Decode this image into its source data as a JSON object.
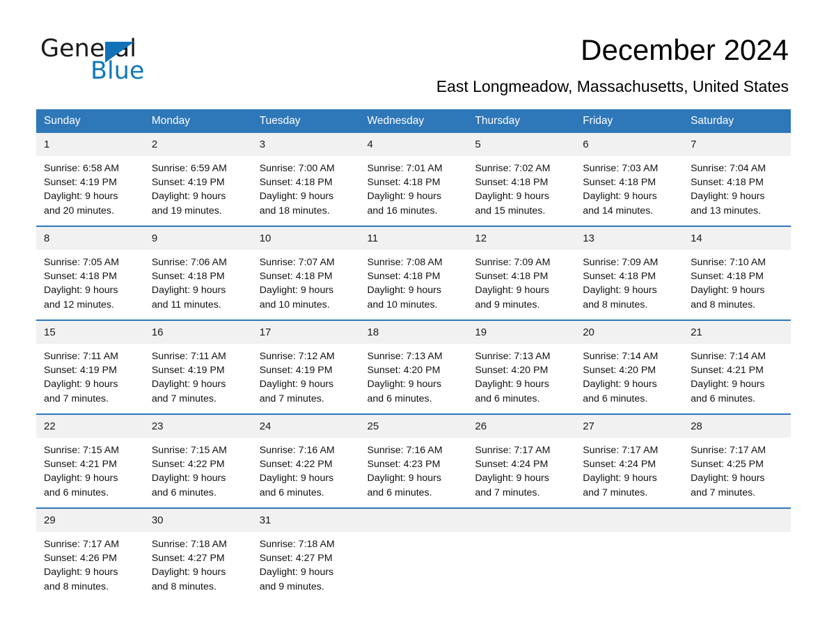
{
  "brand": {
    "name_part1": "General",
    "name_part2": "Blue",
    "triangle_color": "#1272b8",
    "blue_text_color": "#1278be"
  },
  "header": {
    "month_title": "December 2024",
    "location": "East Longmeadow, Massachusetts, United States"
  },
  "calendar": {
    "header_bg": "#2e77b8",
    "daynum_bg": "#f1f1f1",
    "weekday_headers": [
      "Sunday",
      "Monday",
      "Tuesday",
      "Wednesday",
      "Thursday",
      "Friday",
      "Saturday"
    ],
    "weeks": [
      [
        {
          "day": "1",
          "sunrise": "Sunrise: 6:58 AM",
          "sunset": "Sunset: 4:19 PM",
          "daylight_line1": "Daylight: 9 hours",
          "daylight_line2": "and 20 minutes."
        },
        {
          "day": "2",
          "sunrise": "Sunrise: 6:59 AM",
          "sunset": "Sunset: 4:19 PM",
          "daylight_line1": "Daylight: 9 hours",
          "daylight_line2": "and 19 minutes."
        },
        {
          "day": "3",
          "sunrise": "Sunrise: 7:00 AM",
          "sunset": "Sunset: 4:18 PM",
          "daylight_line1": "Daylight: 9 hours",
          "daylight_line2": "and 18 minutes."
        },
        {
          "day": "4",
          "sunrise": "Sunrise: 7:01 AM",
          "sunset": "Sunset: 4:18 PM",
          "daylight_line1": "Daylight: 9 hours",
          "daylight_line2": "and 16 minutes."
        },
        {
          "day": "5",
          "sunrise": "Sunrise: 7:02 AM",
          "sunset": "Sunset: 4:18 PM",
          "daylight_line1": "Daylight: 9 hours",
          "daylight_line2": "and 15 minutes."
        },
        {
          "day": "6",
          "sunrise": "Sunrise: 7:03 AM",
          "sunset": "Sunset: 4:18 PM",
          "daylight_line1": "Daylight: 9 hours",
          "daylight_line2": "and 14 minutes."
        },
        {
          "day": "7",
          "sunrise": "Sunrise: 7:04 AM",
          "sunset": "Sunset: 4:18 PM",
          "daylight_line1": "Daylight: 9 hours",
          "daylight_line2": "and 13 minutes."
        }
      ],
      [
        {
          "day": "8",
          "sunrise": "Sunrise: 7:05 AM",
          "sunset": "Sunset: 4:18 PM",
          "daylight_line1": "Daylight: 9 hours",
          "daylight_line2": "and 12 minutes."
        },
        {
          "day": "9",
          "sunrise": "Sunrise: 7:06 AM",
          "sunset": "Sunset: 4:18 PM",
          "daylight_line1": "Daylight: 9 hours",
          "daylight_line2": "and 11 minutes."
        },
        {
          "day": "10",
          "sunrise": "Sunrise: 7:07 AM",
          "sunset": "Sunset: 4:18 PM",
          "daylight_line1": "Daylight: 9 hours",
          "daylight_line2": "and 10 minutes."
        },
        {
          "day": "11",
          "sunrise": "Sunrise: 7:08 AM",
          "sunset": "Sunset: 4:18 PM",
          "daylight_line1": "Daylight: 9 hours",
          "daylight_line2": "and 10 minutes."
        },
        {
          "day": "12",
          "sunrise": "Sunrise: 7:09 AM",
          "sunset": "Sunset: 4:18 PM",
          "daylight_line1": "Daylight: 9 hours",
          "daylight_line2": "and 9 minutes."
        },
        {
          "day": "13",
          "sunrise": "Sunrise: 7:09 AM",
          "sunset": "Sunset: 4:18 PM",
          "daylight_line1": "Daylight: 9 hours",
          "daylight_line2": "and 8 minutes."
        },
        {
          "day": "14",
          "sunrise": "Sunrise: 7:10 AM",
          "sunset": "Sunset: 4:18 PM",
          "daylight_line1": "Daylight: 9 hours",
          "daylight_line2": "and 8 minutes."
        }
      ],
      [
        {
          "day": "15",
          "sunrise": "Sunrise: 7:11 AM",
          "sunset": "Sunset: 4:19 PM",
          "daylight_line1": "Daylight: 9 hours",
          "daylight_line2": "and 7 minutes."
        },
        {
          "day": "16",
          "sunrise": "Sunrise: 7:11 AM",
          "sunset": "Sunset: 4:19 PM",
          "daylight_line1": "Daylight: 9 hours",
          "daylight_line2": "and 7 minutes."
        },
        {
          "day": "17",
          "sunrise": "Sunrise: 7:12 AM",
          "sunset": "Sunset: 4:19 PM",
          "daylight_line1": "Daylight: 9 hours",
          "daylight_line2": "and 7 minutes."
        },
        {
          "day": "18",
          "sunrise": "Sunrise: 7:13 AM",
          "sunset": "Sunset: 4:20 PM",
          "daylight_line1": "Daylight: 9 hours",
          "daylight_line2": "and 6 minutes."
        },
        {
          "day": "19",
          "sunrise": "Sunrise: 7:13 AM",
          "sunset": "Sunset: 4:20 PM",
          "daylight_line1": "Daylight: 9 hours",
          "daylight_line2": "and 6 minutes."
        },
        {
          "day": "20",
          "sunrise": "Sunrise: 7:14 AM",
          "sunset": "Sunset: 4:20 PM",
          "daylight_line1": "Daylight: 9 hours",
          "daylight_line2": "and 6 minutes."
        },
        {
          "day": "21",
          "sunrise": "Sunrise: 7:14 AM",
          "sunset": "Sunset: 4:21 PM",
          "daylight_line1": "Daylight: 9 hours",
          "daylight_line2": "and 6 minutes."
        }
      ],
      [
        {
          "day": "22",
          "sunrise": "Sunrise: 7:15 AM",
          "sunset": "Sunset: 4:21 PM",
          "daylight_line1": "Daylight: 9 hours",
          "daylight_line2": "and 6 minutes."
        },
        {
          "day": "23",
          "sunrise": "Sunrise: 7:15 AM",
          "sunset": "Sunset: 4:22 PM",
          "daylight_line1": "Daylight: 9 hours",
          "daylight_line2": "and 6 minutes."
        },
        {
          "day": "24",
          "sunrise": "Sunrise: 7:16 AM",
          "sunset": "Sunset: 4:22 PM",
          "daylight_line1": "Daylight: 9 hours",
          "daylight_line2": "and 6 minutes."
        },
        {
          "day": "25",
          "sunrise": "Sunrise: 7:16 AM",
          "sunset": "Sunset: 4:23 PM",
          "daylight_line1": "Daylight: 9 hours",
          "daylight_line2": "and 6 minutes."
        },
        {
          "day": "26",
          "sunrise": "Sunrise: 7:17 AM",
          "sunset": "Sunset: 4:24 PM",
          "daylight_line1": "Daylight: 9 hours",
          "daylight_line2": "and 7 minutes."
        },
        {
          "day": "27",
          "sunrise": "Sunrise: 7:17 AM",
          "sunset": "Sunset: 4:24 PM",
          "daylight_line1": "Daylight: 9 hours",
          "daylight_line2": "and 7 minutes."
        },
        {
          "day": "28",
          "sunrise": "Sunrise: 7:17 AM",
          "sunset": "Sunset: 4:25 PM",
          "daylight_line1": "Daylight: 9 hours",
          "daylight_line2": "and 7 minutes."
        }
      ],
      [
        {
          "day": "29",
          "sunrise": "Sunrise: 7:17 AM",
          "sunset": "Sunset: 4:26 PM",
          "daylight_line1": "Daylight: 9 hours",
          "daylight_line2": "and 8 minutes."
        },
        {
          "day": "30",
          "sunrise": "Sunrise: 7:18 AM",
          "sunset": "Sunset: 4:27 PM",
          "daylight_line1": "Daylight: 9 hours",
          "daylight_line2": "and 8 minutes."
        },
        {
          "day": "31",
          "sunrise": "Sunrise: 7:18 AM",
          "sunset": "Sunset: 4:27 PM",
          "daylight_line1": "Daylight: 9 hours",
          "daylight_line2": "and 9 minutes."
        },
        {
          "day": "",
          "sunrise": "",
          "sunset": "",
          "daylight_line1": "",
          "daylight_line2": ""
        },
        {
          "day": "",
          "sunrise": "",
          "sunset": "",
          "daylight_line1": "",
          "daylight_line2": ""
        },
        {
          "day": "",
          "sunrise": "",
          "sunset": "",
          "daylight_line1": "",
          "daylight_line2": ""
        },
        {
          "day": "",
          "sunrise": "",
          "sunset": "",
          "daylight_line1": "",
          "daylight_line2": ""
        }
      ]
    ]
  }
}
